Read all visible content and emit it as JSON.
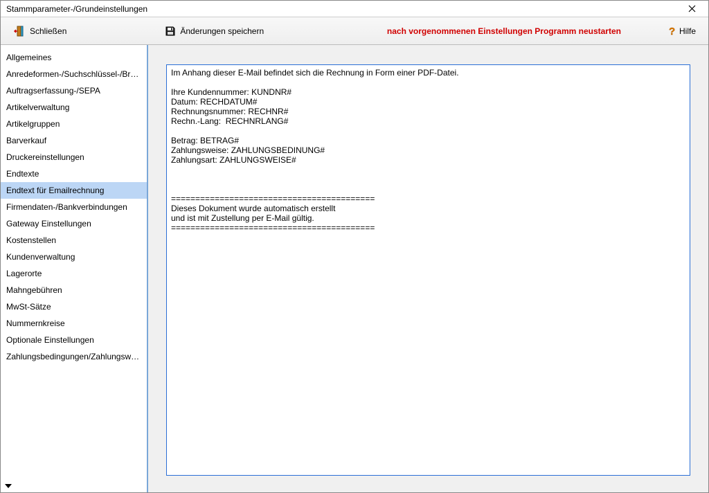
{
  "window": {
    "title": "Stammparameter-/Grundeinstellungen"
  },
  "toolbar": {
    "close_label": "Schließen",
    "save_label": "Änderungen speichern",
    "notice": "nach vorgenommenen Einstellungen Programm neustarten",
    "help_label": "Hilfe"
  },
  "sidebar": {
    "items": [
      "Allgemeines",
      "Anredeformen-/Suchschlüssel-/Branchen",
      "Auftragserfassung-/SEPA",
      "Artikelverwaltung",
      "Artikelgruppen",
      "Barverkauf",
      "Druckereinstellungen",
      "Endtexte",
      "Endtext für Emailrechnung",
      "Firmendaten-/Bankverbindungen",
      "Gateway Einstellungen",
      "Kostenstellen",
      "Kundenverwaltung",
      "Lagerorte",
      "Mahngebühren",
      "MwSt-Sätze",
      "Nummernkreise",
      "Optionale Einstellungen",
      "Zahlungsbedingungen/Zahlungsweisen"
    ],
    "selected_index": 8
  },
  "editor": {
    "text": "Im Anhang dieser E-Mail befindet sich die Rechnung in Form einer PDF-Datei.\n\nIhre Kundennummer: KUNDNR#\nDatum: RECHDATUM#\nRechnungsnummer: RECHNR#\nRechn.-Lang:  RECHNRLANG#\n\nBetrag: BETRAG#\nZahlungsweise: ZAHLUNGSBEDINUNG#\nZahlungsart: ZAHLUNGSWEISE#\n\n\n\n==========================================\nDieses Dokument wurde automatisch erstellt\nund ist mit Zustellung per E-Mail gültig.\n=========================================="
  }
}
